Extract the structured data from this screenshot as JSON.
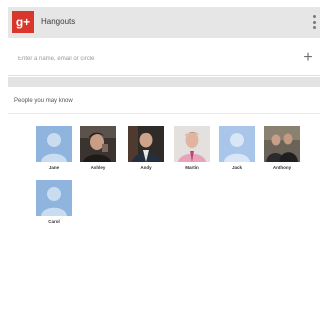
{
  "app": {
    "title": "Hangouts",
    "logo_text": "g+",
    "brand_color": "#d7382b"
  },
  "search": {
    "placeholder": "Enter a name, email or circle",
    "add_icon": "plus-icon"
  },
  "suggestions": {
    "heading": "People you may know",
    "people": [
      {
        "name": "Jane",
        "avatar": "default-avatar"
      },
      {
        "name": "Ashley",
        "avatar": "photo"
      },
      {
        "name": "Andy",
        "avatar": "photo"
      },
      {
        "name": "Martin",
        "avatar": "photo"
      },
      {
        "name": "Jack",
        "avatar": "default-avatar"
      },
      {
        "name": "Anthony",
        "avatar": "photo"
      },
      {
        "name": "Carol",
        "avatar": "default-avatar"
      }
    ]
  }
}
